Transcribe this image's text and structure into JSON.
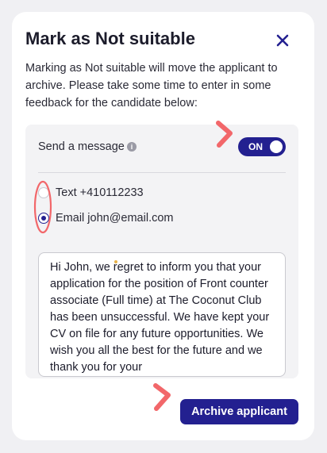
{
  "modal": {
    "title": "Mark as Not suitable",
    "close_icon": "close-icon",
    "intro": "Marking as Not suitable will move the applicant to archive. Please take some time to enter in some feedback for the candidate below:"
  },
  "message_panel": {
    "send_label": "Send a message",
    "info_icon": "info-icon",
    "toggle": {
      "label": "ON",
      "state": "on"
    },
    "options": [
      {
        "label": "Text +410112233",
        "selected": false
      },
      {
        "label": "Email john@email.com",
        "selected": true
      }
    ],
    "message": "Hi John, we regret to inform you that your application for the position of Front counter associate (Full time) at The Coconut Club has been unsuccessful. We have kept your CV on file for any future opportunities. We wish you all the best for the future and we thank you for your"
  },
  "actions": {
    "archive_label": "Archive applicant"
  },
  "colors": {
    "accent": "#232090",
    "annotation": "#f2676a",
    "panel_bg": "#f3f3f5",
    "page_bg": "#f0f0f3"
  }
}
